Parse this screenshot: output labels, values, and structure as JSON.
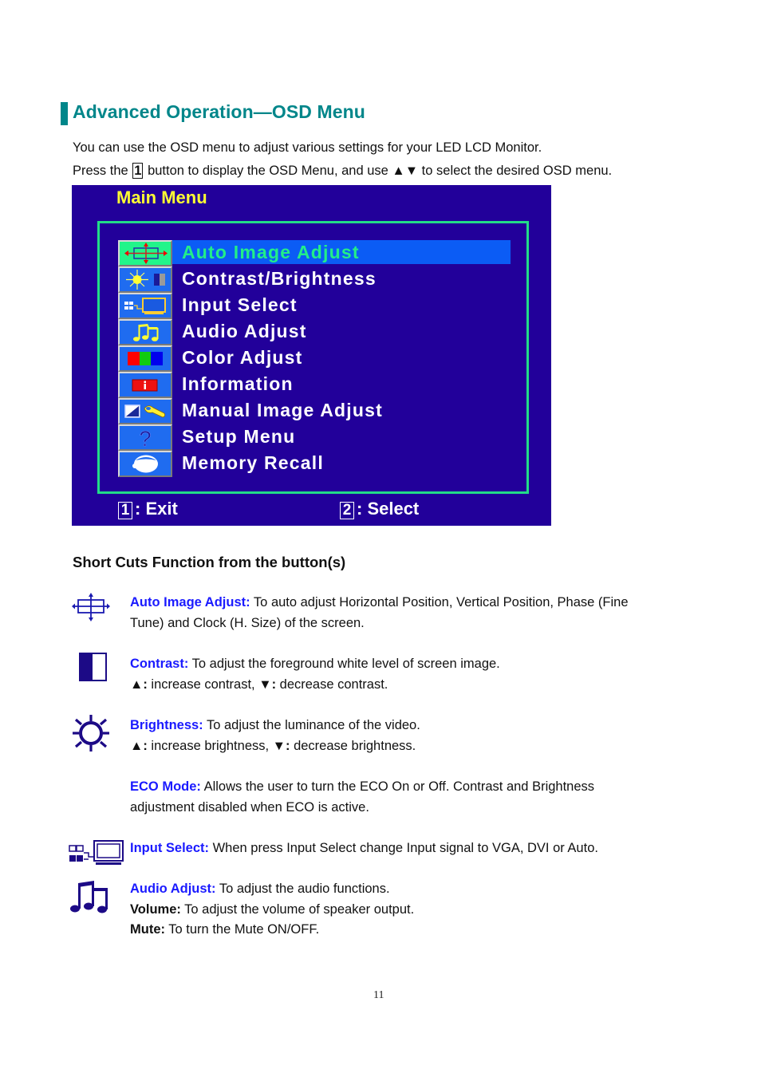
{
  "heading": "Advanced Operation—OSD Menu",
  "intro": {
    "line1": "You can use the OSD menu to adjust various settings for your LED LCD Monitor.",
    "line2_before": "Press the",
    "line2_key": "1",
    "line2_after": "button to display the OSD Menu, and use ▲▼ to select the desired OSD menu."
  },
  "osd": {
    "title": "Main Menu",
    "selected_index": 0,
    "items": [
      {
        "label": "Auto Image Adjust",
        "icon": "auto-adjust-icon"
      },
      {
        "label": "Contrast/Brightness",
        "icon": "contrast-brightness-icon"
      },
      {
        "label": "Input Select",
        "icon": "input-select-icon"
      },
      {
        "label": "Audio Adjust",
        "icon": "audio-icon"
      },
      {
        "label": "Color Adjust",
        "icon": "color-rgb-icon"
      },
      {
        "label": "Information",
        "icon": "information-icon"
      },
      {
        "label": "Manual Image Adjust",
        "icon": "manual-adjust-icon"
      },
      {
        "label": "Setup Menu",
        "icon": "question-icon"
      },
      {
        "label": "Memory Recall",
        "icon": "memory-recall-icon"
      }
    ],
    "footer": {
      "exit_key": "1",
      "exit_label": ": Exit",
      "select_key": "2",
      "select_label": ": Select"
    },
    "colors": {
      "background": "#22009a",
      "frame": "#22dd88",
      "highlight": "#0b5cf5",
      "title": "#ffff33"
    }
  },
  "shortcuts": {
    "title": "Short Cuts Function from the button(s)",
    "auto": {
      "label": "Auto Image Adjust:",
      "line1": " To auto adjust Horizontal Position, Vertical Position, Phase (Fine",
      "line2": "Tune) and Clock (H. Size) of the screen."
    },
    "contrast": {
      "label": "Contrast:",
      "line1": " To adjust the foreground white level of screen image.",
      "up": "▲:",
      "up_text": " increase contrast, ",
      "down": "▼:",
      "down_text": " decrease contrast."
    },
    "brightness": {
      "label": "Brightness:",
      "line1": " To adjust the luminance of the video.",
      "up": "▲:",
      "up_text": " increase brightness, ",
      "down": "▼:",
      "down_text": " decrease brightness."
    },
    "eco": {
      "label": "ECO Mode:",
      "line1": " Allows the user to turn the ECO On or Off. Contrast and Brightness",
      "line2": "adjustment disabled when ECO is active."
    },
    "input": {
      "label": "Input Select:",
      "line1": " When press Input Select change Input signal to VGA, DVI or Auto."
    },
    "audio": {
      "label": "Audio Adjust:",
      "line1": " To adjust the audio functions.",
      "volume_label": "Volume:",
      "volume_text": " To adjust the volume of speaker output.",
      "mute_label": "Mute:",
      "mute_text": " To turn the Mute ON/OFF."
    }
  },
  "page_number": "11",
  "colors": {
    "heading": "#00868a",
    "label_blue": "#1a1aff",
    "icon_navy": "#1c0a86"
  }
}
